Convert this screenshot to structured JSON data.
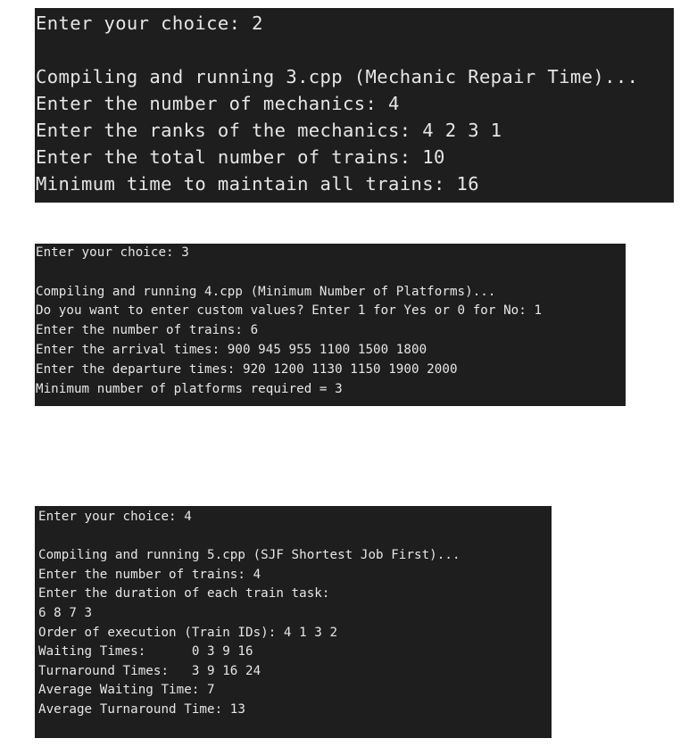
{
  "terminal_1": {
    "lines": [
      "Enter your choice: 2",
      "",
      "Compiling and running 3.cpp (Mechanic Repair Time)...",
      "Enter the number of mechanics: 4",
      "Enter the ranks of the mechanics: 4 2 3 1",
      "Enter the total number of trains: 10",
      "Minimum time to maintain all trains: 16"
    ]
  },
  "terminal_2": {
    "lines": [
      "Enter your choice: 3",
      "",
      "Compiling and running 4.cpp (Minimum Number of Platforms)...",
      "Do you want to enter custom values? Enter 1 for Yes or 0 for No: 1",
      "Enter the number of trains: 6",
      "Enter the arrival times: 900 945 955 1100 1500 1800",
      "Enter the departure times: 920 1200 1130 1150 1900 2000",
      "Minimum number of platforms required = 3"
    ]
  },
  "terminal_3": {
    "lines": [
      "Enter your choice: 4",
      "",
      "Compiling and running 5.cpp (SJF Shortest Job First)...",
      "Enter the number of trains: 4",
      "Enter the duration of each train task:",
      "6 8 7 3",
      "Order of execution (Train IDs): 4 1 3 2",
      "Waiting Times:      0 3 9 16",
      "Turnaround Times:   3 9 16 24",
      "Average Waiting Time: 7",
      "Average Turnaround Time: 13"
    ]
  },
  "colors": {
    "terminal_background": "#1e1e1e",
    "terminal_text": "#e6e6e6",
    "page_background": "#ffffff"
  }
}
